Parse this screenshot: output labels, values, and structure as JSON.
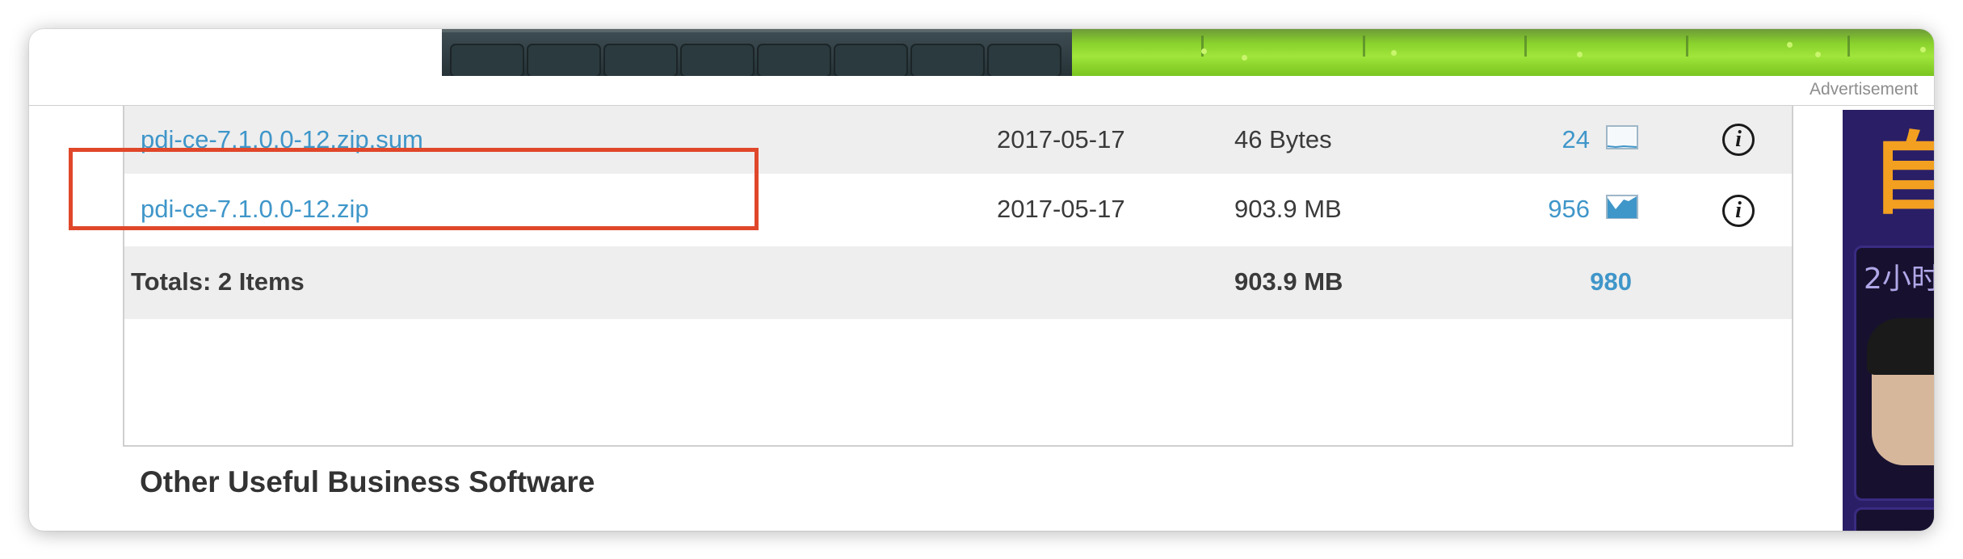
{
  "ad_label": "Advertisement",
  "files": [
    {
      "name": "pdi-ce-7.1.0.0-12.zip.sum",
      "date": "2017-05-17",
      "size": "46 Bytes",
      "downloads": "24"
    },
    {
      "name": "pdi-ce-7.1.0.0-12.zip",
      "date": "2017-05-17",
      "size": "903.9 MB",
      "downloads": "956"
    }
  ],
  "totals": {
    "label": "Totals: 2 Items",
    "size": "903.9 MB",
    "downloads": "980"
  },
  "section_title": "Other Useful Business Software",
  "side_ad": {
    "headline_char": "自",
    "text": "2小时"
  },
  "icons": {
    "chart": "download-chart-icon",
    "info": "info-icon"
  },
  "colors": {
    "link": "#3f96c9",
    "highlight": "#e0472a",
    "row_alt": "#eeeeee"
  }
}
